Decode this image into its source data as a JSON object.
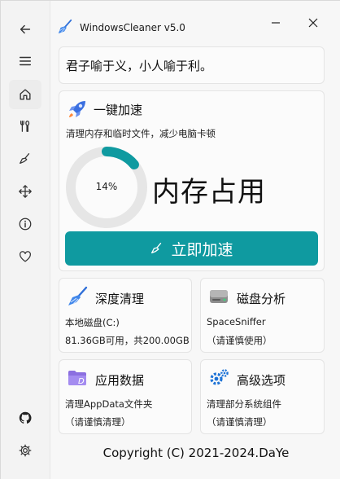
{
  "app": {
    "title": "WindowsCleaner v5.0"
  },
  "quote": "君子喻于义，小人喻于利。",
  "accelerate": {
    "title": "一键加速",
    "description": "清理内存和临时文件，减少电脑卡顿",
    "memory_usage_percent": 14,
    "memory_usage_label": "14%",
    "memory_caption": "内存占用",
    "button_label": "立即加速"
  },
  "tiles": {
    "deep_clean": {
      "title": "深度清理",
      "line1": "本地磁盘(C:)",
      "line2": "81.36GB可用，共200.00GB"
    },
    "disk_analysis": {
      "title": "磁盘分析",
      "line1": "SpaceSniffer",
      "line2": "（请谨慎使用）"
    },
    "app_data": {
      "title": "应用数据",
      "line1": "清理AppData文件夹",
      "line2": "（请谨慎清理）"
    },
    "advanced": {
      "title": "高级选项",
      "line1": "清理部分系统组件",
      "line2": "（请谨慎清理）"
    }
  },
  "footer": "Copyright (C) 2021-2024.DaYe",
  "nav": {
    "items": [
      "back-icon",
      "menu-icon",
      "home-icon",
      "tools-icon",
      "broom-icon",
      "move-icon",
      "info-icon",
      "heart-icon",
      "github-icon",
      "gear-icon"
    ],
    "active": "home-icon"
  },
  "colors": {
    "accent": "#0f9aa0",
    "ring_track": "#e6e6e6",
    "rocket": "#3b6fe0",
    "disk_icon": "#1e73d6"
  }
}
